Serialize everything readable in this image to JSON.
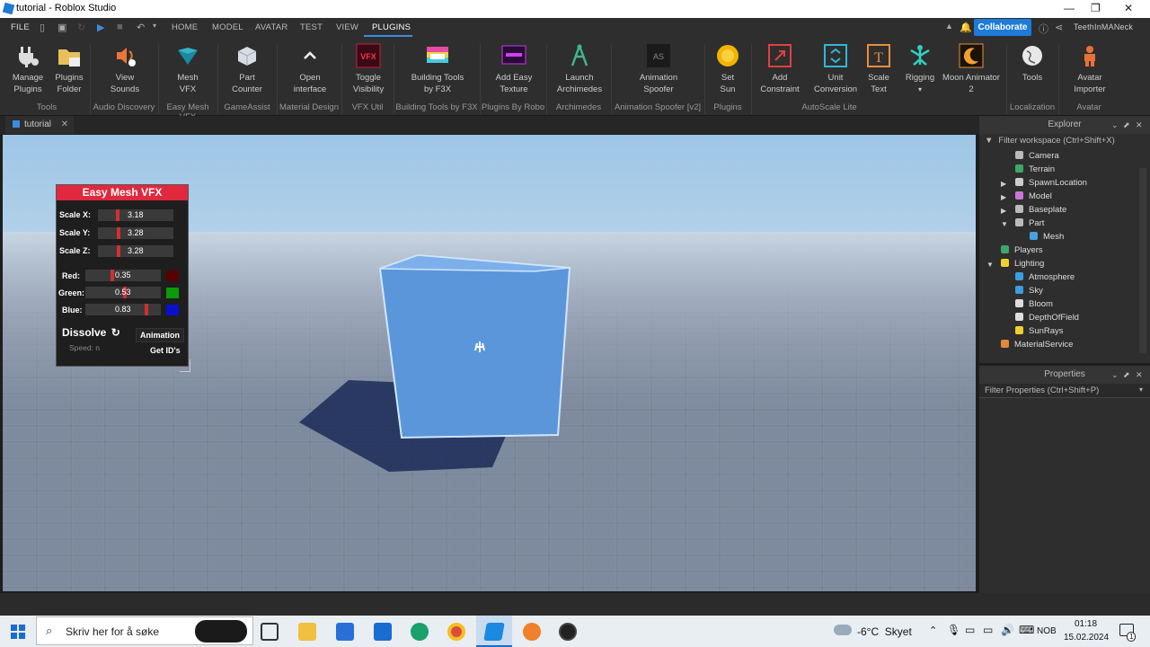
{
  "window": {
    "title": "tutorial - Roblox Studio",
    "controls": [
      "minimize",
      "maximize",
      "close"
    ]
  },
  "menu": {
    "file": "FILE",
    "tabs": [
      "HOME",
      "MODEL",
      "AVATAR",
      "TEST",
      "VIEW",
      "PLUGINS"
    ],
    "active_tab": "PLUGINS",
    "collaborate": "Collaborate",
    "username": "TeethInMANeck"
  },
  "ribbon": {
    "buttons": [
      {
        "label1": "Manage",
        "label2": "Plugins",
        "icon": "plug-icon"
      },
      {
        "label1": "Plugins",
        "label2": "Folder",
        "icon": "folder-icon"
      },
      {
        "label1": "View",
        "label2": "Sounds",
        "icon": "speaker-icon"
      },
      {
        "label1": "Mesh",
        "label2": "VFX",
        "icon": "mesh-vfx-icon"
      },
      {
        "label1": "Part",
        "label2": "Counter",
        "icon": "part-counter-icon"
      },
      {
        "label1": "Open",
        "label2": "interface",
        "icon": "chevron-up-icon"
      },
      {
        "label1": "Toggle",
        "label2": "Visibility",
        "icon": "vfx-icon"
      },
      {
        "label1": "Building Tools",
        "label2": "by F3X",
        "icon": "f3x-icon"
      },
      {
        "label1": "Add Easy",
        "label2": "Texture",
        "icon": "texture-icon"
      },
      {
        "label1": "Launch",
        "label2": "Archimedes",
        "icon": "archimedes-icon"
      },
      {
        "label1": "Animation",
        "label2": "Spoofer",
        "icon": "animation-spoofer-icon"
      },
      {
        "label1": "Set",
        "label2": "Sun",
        "icon": "sun-icon"
      },
      {
        "label1": "Add",
        "label2": "Constraint",
        "icon": "constraint-icon"
      },
      {
        "label1": "Unit",
        "label2": "Conversion",
        "icon": "unit-conversion-icon"
      },
      {
        "label1": "Scale",
        "label2": "Text",
        "icon": "scale-text-icon"
      },
      {
        "label1": "Rigging",
        "label2": "",
        "icon": "rigging-icon"
      },
      {
        "label1": "Moon Animator",
        "label2": "2",
        "icon": "moon-icon"
      },
      {
        "label1": "Tools",
        "label2": "",
        "icon": "globe-icon"
      },
      {
        "label1": "Avatar",
        "label2": "Importer",
        "icon": "avatar-importer-icon"
      }
    ],
    "groups": [
      "Tools",
      "Audio Discovery",
      "Easy Mesh VFX",
      "GameAssist",
      "Material Design",
      "VFX Util",
      "Building Tools by F3X",
      "Plugins By Robo",
      "Archimedes",
      "Animation Spoofer [v2]",
      "Plugins",
      "AutoScale Lite",
      "Localization",
      "Avatar"
    ]
  },
  "document_tab": {
    "label": "tutorial"
  },
  "mesh_panel": {
    "title": "Easy Mesh VFX",
    "scales": [
      {
        "label": "Scale X:",
        "value": "3.18",
        "level": 0.25
      },
      {
        "label": "Scale Y:",
        "value": "3.28",
        "level": 0.26
      },
      {
        "label": "Scale Z:",
        "value": "3.28",
        "level": 0.26
      }
    ],
    "colors": [
      {
        "label": "Red:",
        "value": "0.35",
        "level": 0.35,
        "swatch": "#5a0000"
      },
      {
        "label": "Green:",
        "value": "0.53",
        "level": 0.53,
        "swatch": "#0a9a0a"
      },
      {
        "label": "Blue:",
        "value": "0.83",
        "level": 0.83,
        "swatch": "#0a10cc"
      }
    ],
    "dissolve": "Dissolve",
    "speed": "Speed: n",
    "animation": "Animation",
    "get_ids": "Get ID's"
  },
  "explorer": {
    "title": "Explorer",
    "filter": "Filter workspace (Ctrl+Shift+X)",
    "items": [
      {
        "label": "Camera",
        "color": "#bbbbbb"
      },
      {
        "label": "Terrain",
        "color": "#3fa66a"
      },
      {
        "label": "SpawnLocation",
        "color": "#cccccc"
      },
      {
        "label": "Model",
        "color": "#c978d8"
      },
      {
        "label": "Baseplate",
        "color": "#bbbbbb"
      },
      {
        "label": "Part",
        "color": "#bbbbbb"
      },
      {
        "label": "Mesh",
        "color": "#4aa0e0"
      },
      {
        "label": "Players",
        "color": "#3fa66a"
      },
      {
        "label": "Lighting",
        "color": "#f0d030"
      },
      {
        "label": "Atmosphere",
        "color": "#3a9ee0"
      },
      {
        "label": "Sky",
        "color": "#3a9ee0"
      },
      {
        "label": "Bloom",
        "color": "#dddddd"
      },
      {
        "label": "DepthOfField",
        "color": "#dddddd"
      },
      {
        "label": "SunRays",
        "color": "#f0d030"
      },
      {
        "label": "MaterialService",
        "color": "#e08a3a"
      }
    ]
  },
  "properties": {
    "title": "Properties",
    "filter": "Filter Properties (Ctrl+Shift+P)"
  },
  "taskbar": {
    "search_placeholder": "Skriv her for å søke",
    "weather": "-6°C  Skyet",
    "lang": "NOB",
    "time": "01:18",
    "date": "15.02.2024",
    "notif": "1"
  }
}
